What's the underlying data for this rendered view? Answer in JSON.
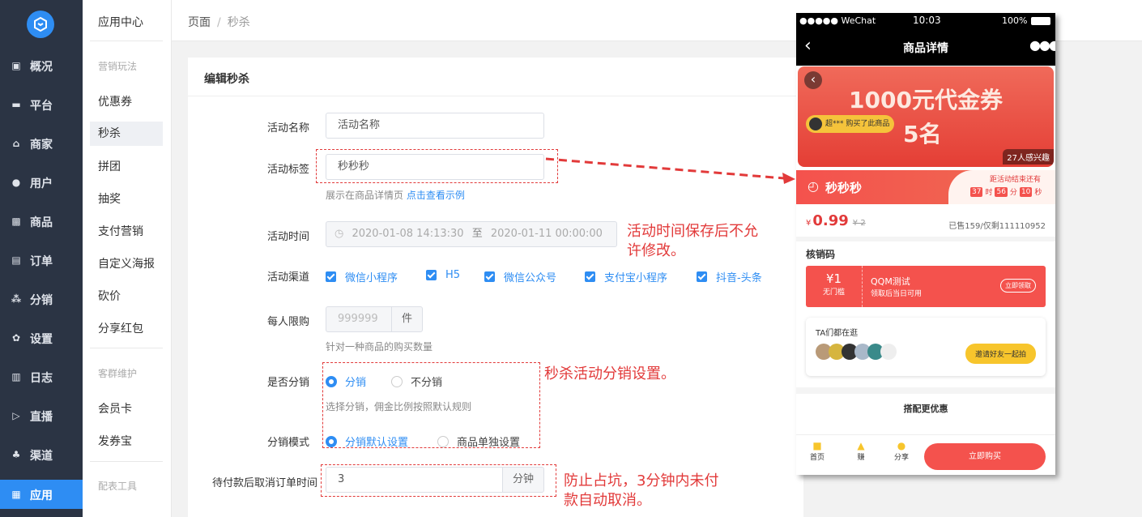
{
  "nav": {
    "items": [
      {
        "label": "概况",
        "icon": "chart-icon"
      },
      {
        "label": "平台",
        "icon": "monitor-icon"
      },
      {
        "label": "商家",
        "icon": "store-icon"
      },
      {
        "label": "用户",
        "icon": "user-icon"
      },
      {
        "label": "商品",
        "icon": "goods-icon"
      },
      {
        "label": "订单",
        "icon": "order-icon"
      },
      {
        "label": "分销",
        "icon": "distribution-icon"
      },
      {
        "label": "设置",
        "icon": "gear-icon"
      },
      {
        "label": "日志",
        "icon": "log-icon"
      },
      {
        "label": "直播",
        "icon": "live-icon"
      },
      {
        "label": "渠道",
        "icon": "channel-icon"
      },
      {
        "label": "应用",
        "icon": "apps-icon"
      }
    ]
  },
  "subnav": {
    "title": "应用中心",
    "section1": "营销玩法",
    "items1": [
      "优惠券",
      "秒杀",
      "拼团",
      "抽奖",
      "支付营销",
      "自定义海报",
      "砍价",
      "分享红包"
    ],
    "section2": "客群维护",
    "items2": [
      "会员卡",
      "发券宝"
    ],
    "section3": "配表工具"
  },
  "breadcrumb": {
    "root": "页面",
    "sep": "/",
    "current": "秒杀"
  },
  "panel": {
    "title": "编辑秒杀"
  },
  "form": {
    "name_label": "活动名称",
    "name_value": "活动名称",
    "tag_label": "活动标签",
    "tag_value": "秒秒秒",
    "tag_hint": "展示在商品详情页 ",
    "tag_hint_link": "点击查看示例",
    "time_label": "活动时间",
    "time_start": "2020-01-08 14:13:30",
    "time_to": "至",
    "time_end": "2020-01-11 00:00:00",
    "channel_label": "活动渠道",
    "channels": [
      "微信小程序",
      "H5",
      "微信公众号",
      "支付宝小程序",
      "抖音-头条"
    ],
    "limit_label": "每人限购",
    "limit_placeholder": "999999",
    "limit_unit": "件",
    "limit_hint": "针对一种商品的购买数量",
    "dist_label": "是否分销",
    "dist_on": "分销",
    "dist_off": "不分销",
    "dist_hint": "选择分销，佣金比例按照默认规则",
    "mode_label": "分销模式",
    "mode_default": "分销默认设置",
    "mode_single": "商品单独设置",
    "cancel_label": "待付款后取消订单时间",
    "cancel_value": "3",
    "cancel_unit": "分钟"
  },
  "notes": {
    "time_note": "活动时间保存后不允许修改。",
    "dist_note": "秒杀活动分销设置。",
    "cancel_note": "防止占坑，3分钟内未付款自动取消。"
  },
  "phone": {
    "carrier": "●●●●● WeChat",
    "time": "10:03",
    "battery": "100%",
    "title": "商品详情",
    "banner_line1": "1000元代金券",
    "banner_line2": "5名",
    "buyer_note": "超*** 购买了此商品",
    "interest": "27人感兴趣",
    "seckill_tag": "秒秒秒",
    "countdown_label": "距活动结束还有",
    "countdown": {
      "h": "37",
      "h_unit": "时",
      "m": "56",
      "m_unit": "分",
      "s": "10",
      "s_unit": "秒"
    },
    "price_symbol": "¥",
    "price": "0.99",
    "orig_price": "¥ 2",
    "sold": "已售159/仅剩111110952",
    "coupon_section": "核销码",
    "coupon_amount": "¥1",
    "coupon_cond": "无门槛",
    "coupon_name": "QQM测试",
    "coupon_desc": "领取后当日可用",
    "coupon_btn": "立即领取",
    "ta_title": "TA们都在逛",
    "invite_btn": "邀请好友一起拍",
    "match_title": "搭配更优惠",
    "tabs": [
      "首页",
      "赚",
      "分享"
    ],
    "buy_btn": "立即购买"
  },
  "colors": {
    "accent": "#2e8df3",
    "sidebar": "#2b3444",
    "alert": "#e23a3a"
  }
}
